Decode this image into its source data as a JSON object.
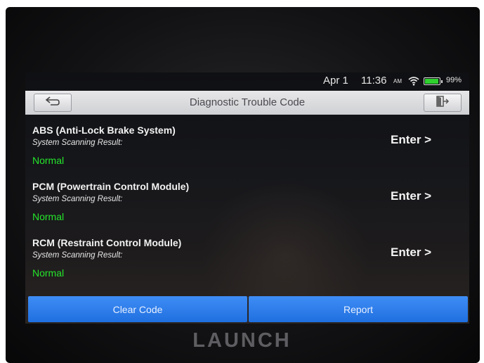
{
  "status_bar": {
    "date": "Apr 1",
    "time": "11:36",
    "ampm": "AM",
    "battery": "99%",
    "wifi_icon": "wifi-icon",
    "battery_icon": "battery-icon"
  },
  "header": {
    "title": "Diagnostic Trouble Code",
    "back_icon": "back-arrow-icon",
    "exit_icon": "exit-icon"
  },
  "systems": [
    {
      "name": "ABS (Anti-Lock Brake System)",
      "result_label": "System Scanning Result:",
      "status": "Normal",
      "action": "Enter >"
    },
    {
      "name": "PCM (Powertrain Control Module)",
      "result_label": "System Scanning Result:",
      "status": "Normal",
      "action": "Enter >"
    },
    {
      "name": "RCM (Restraint Control Module)",
      "result_label": "System Scanning Result:",
      "status": "Normal",
      "action": "Enter >"
    }
  ],
  "footer": {
    "clear_code": "Clear Code",
    "report": "Report"
  },
  "device_brand": "LAUNCH",
  "colors": {
    "status_ok": "#25e52b",
    "button_blue": "#2a7ef0",
    "title_bar": "#dcdde0"
  }
}
